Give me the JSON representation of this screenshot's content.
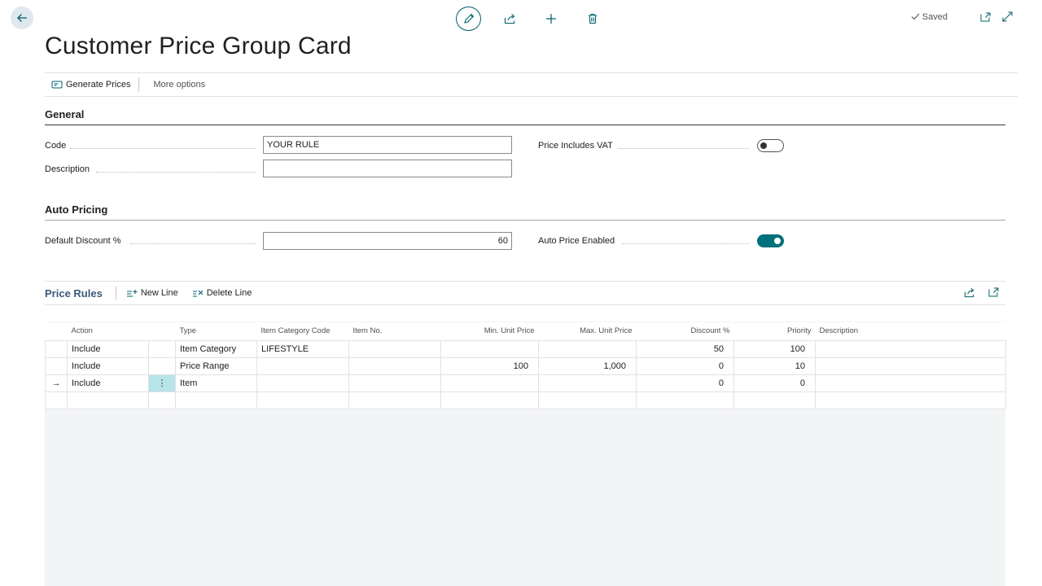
{
  "header": {
    "saved_label": "Saved",
    "icons": [
      "back-arrow-icon",
      "edit-icon",
      "share-icon",
      "add-icon",
      "delete-icon",
      "checkmark-icon",
      "open-new-window-icon",
      "expand-icon"
    ]
  },
  "page_title": "Customer Price Group Card",
  "actions": {
    "generate_prices": "Generate Prices",
    "more_options": "More options"
  },
  "general": {
    "title": "General",
    "code_label": "Code",
    "code_value": "YOUR RULE",
    "description_label": "Description",
    "description_value": "",
    "price_includes_vat_label": "Price Includes VAT",
    "price_includes_vat": false
  },
  "auto_pricing": {
    "title": "Auto Pricing",
    "default_discount_label": "Default Discount %",
    "default_discount_value": "60",
    "auto_price_enabled_label": "Auto Price Enabled",
    "auto_price_enabled": true
  },
  "price_rules": {
    "title": "Price Rules",
    "new_line": "New Line",
    "delete_line": "Delete Line",
    "columns": {
      "action": "Action",
      "type": "Type",
      "item_category_code": "Item Category Code",
      "item_no": "Item No.",
      "min_unit_price": "Min. Unit Price",
      "max_unit_price": "Max. Unit Price",
      "discount": "Discount %",
      "priority": "Priority",
      "description": "Description"
    },
    "rows": [
      {
        "action": "Include",
        "type": "Item Category",
        "item_category_code": "LIFESTYLE",
        "item_no": "",
        "min_unit_price": "",
        "max_unit_price": "",
        "discount": "50",
        "priority": "100",
        "description": ""
      },
      {
        "action": "Include",
        "type": "Price Range",
        "item_category_code": "",
        "item_no": "",
        "min_unit_price": "100",
        "max_unit_price": "1,000",
        "discount": "0",
        "priority": "10",
        "description": ""
      },
      {
        "action": "Include",
        "type": "Item",
        "item_category_code": "",
        "item_no": "",
        "min_unit_price": "",
        "max_unit_price": "",
        "discount": "0",
        "priority": "0",
        "description": ""
      },
      {
        "action": "",
        "type": "",
        "item_category_code": "",
        "item_no": "",
        "min_unit_price": "",
        "max_unit_price": "",
        "discount": "",
        "priority": "",
        "description": ""
      }
    ],
    "row_menu_glyph": "⋮",
    "current_row_glyph": "→"
  }
}
